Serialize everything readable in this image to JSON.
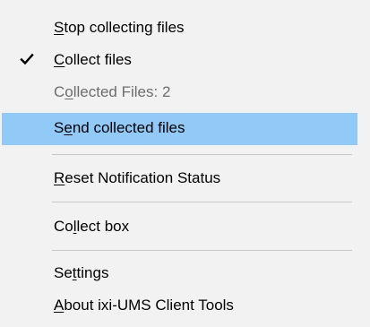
{
  "menu": {
    "items": [
      {
        "pre": "",
        "key": "S",
        "post": "top collecting files",
        "checked": false,
        "disabled": false,
        "highlighted": false
      },
      {
        "pre": "",
        "key": "C",
        "post": "ollect files",
        "checked": true,
        "disabled": false,
        "highlighted": false
      },
      {
        "pre": "C",
        "key": "o",
        "post": "llected Files: 2",
        "checked": false,
        "disabled": true,
        "highlighted": false
      },
      {
        "pre": "S",
        "key": "e",
        "post": "nd collected files",
        "checked": false,
        "disabled": false,
        "highlighted": true
      },
      {
        "pre": "",
        "key": "R",
        "post": "eset Notification Status",
        "checked": false,
        "disabled": false,
        "highlighted": false
      },
      {
        "pre": "Co",
        "key": "l",
        "post": "lect box",
        "checked": false,
        "disabled": false,
        "highlighted": false
      },
      {
        "pre": "Se",
        "key": "t",
        "post": "tings",
        "checked": false,
        "disabled": false,
        "highlighted": false
      },
      {
        "pre": "",
        "key": "A",
        "post": "bout ixi-UMS Client Tools",
        "checked": false,
        "disabled": false,
        "highlighted": false
      }
    ]
  },
  "colors": {
    "menu_background": "#f2f2f2",
    "highlight": "#91c9f7",
    "disabled_text": "#6d6d6d",
    "separator": "#c8c8c8"
  },
  "icons": {
    "check": "checkmark-icon"
  }
}
